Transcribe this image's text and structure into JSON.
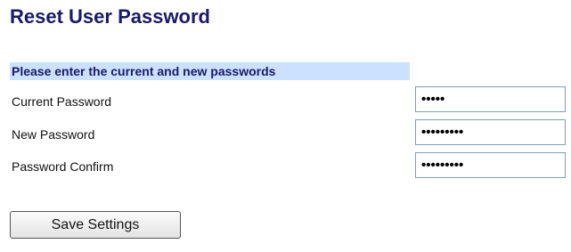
{
  "page": {
    "title": "Reset User Password"
  },
  "form": {
    "section_header": "Please enter the current and new passwords",
    "fields": [
      {
        "label": "Current Password",
        "value": "12345"
      },
      {
        "label": "New Password",
        "value": "abcdefghi"
      },
      {
        "label": "Password Confirm",
        "value": "abcdefghi"
      }
    ],
    "save_label": "Save Settings"
  },
  "colors": {
    "title": "#1a1a66",
    "section_header_bg": "#cce0ff",
    "input_border": "#7f9db9"
  }
}
